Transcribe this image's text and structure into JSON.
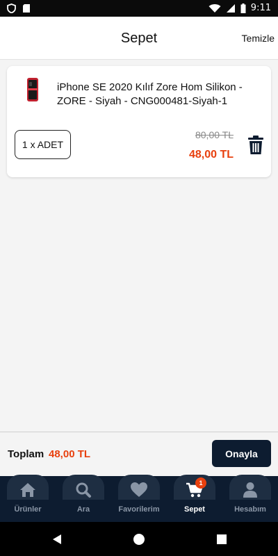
{
  "status_bar": {
    "time": "9:11"
  },
  "header": {
    "title": "Sepet",
    "clear_label": "Temizle"
  },
  "cart": {
    "items": [
      {
        "name": "iPhone SE 2020 Kılıf Zore Hom Silikon - ZORE - Siyah - CNG000481-Siyah-1",
        "quantity_label": "1 x ADET",
        "old_price": "80,00 TL",
        "price": "48,00 TL",
        "icon": "phone-case-thumbnail"
      }
    ]
  },
  "summary": {
    "total_label": "Toplam",
    "total_value": "48,00 TL",
    "confirm_label": "Onayla"
  },
  "tabs": [
    {
      "label": "Ürünler",
      "icon": "home-icon"
    },
    {
      "label": "Ara",
      "icon": "search-icon"
    },
    {
      "label": "Favorilerim",
      "icon": "heart-icon"
    },
    {
      "label": "Sepet",
      "icon": "cart-icon",
      "badge": "1",
      "active": true
    },
    {
      "label": "Hesabım",
      "icon": "user-icon"
    }
  ],
  "colors": {
    "primary": "#0d1c30",
    "accent": "#e8400e",
    "background": "#f4f4f4"
  }
}
